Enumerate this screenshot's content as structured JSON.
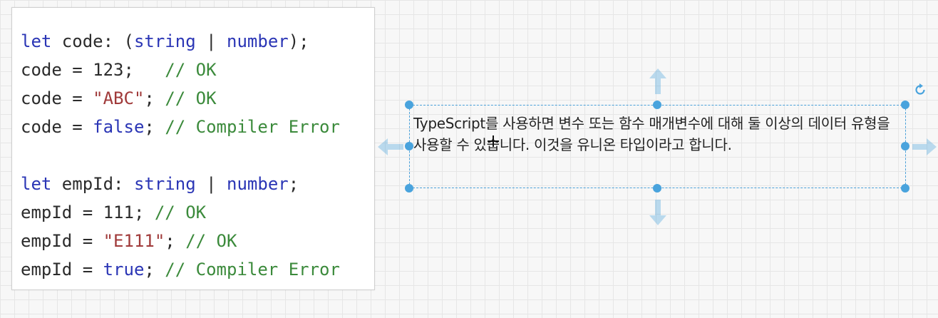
{
  "code_block": {
    "lines": [
      [
        {
          "t": "let",
          "k": "kw"
        },
        {
          "t": " code: (",
          "k": "plain"
        },
        {
          "t": "string",
          "k": "type"
        },
        {
          "t": " | ",
          "k": "plain"
        },
        {
          "t": "number",
          "k": "type"
        },
        {
          "t": ");",
          "k": "plain"
        }
      ],
      [
        {
          "t": "code = 123;   ",
          "k": "plain"
        },
        {
          "t": "// OK",
          "k": "cmt"
        }
      ],
      [
        {
          "t": "code = ",
          "k": "plain"
        },
        {
          "t": "\"ABC\"",
          "k": "str"
        },
        {
          "t": "; ",
          "k": "plain"
        },
        {
          "t": "// OK",
          "k": "cmt"
        }
      ],
      [
        {
          "t": "code = ",
          "k": "plain"
        },
        {
          "t": "false",
          "k": "kw"
        },
        {
          "t": "; ",
          "k": "plain"
        },
        {
          "t": "// Compiler Error",
          "k": "cmt"
        }
      ],
      [],
      [
        {
          "t": "let",
          "k": "kw"
        },
        {
          "t": " empId: ",
          "k": "plain"
        },
        {
          "t": "string",
          "k": "type"
        },
        {
          "t": " | ",
          "k": "plain"
        },
        {
          "t": "number",
          "k": "type"
        },
        {
          "t": ";",
          "k": "plain"
        }
      ],
      [
        {
          "t": "empId = 111; ",
          "k": "plain"
        },
        {
          "t": "// OK",
          "k": "cmt"
        }
      ],
      [
        {
          "t": "empId = ",
          "k": "plain"
        },
        {
          "t": "\"E111\"",
          "k": "str"
        },
        {
          "t": "; ",
          "k": "plain"
        },
        {
          "t": "// OK",
          "k": "cmt"
        }
      ],
      [
        {
          "t": "empId = ",
          "k": "plain"
        },
        {
          "t": "true",
          "k": "kw"
        },
        {
          "t": "; ",
          "k": "plain"
        },
        {
          "t": "// Compiler Error",
          "k": "cmt"
        }
      ]
    ]
  },
  "text_box": {
    "text": "TypeScript를 사용하면 변수 또는 함수 매개변수에 대해 둘 이상의 데이터 유형을 사용할 수 있습니다. 이것을 유니온 타입이라고 합니다."
  },
  "icons": {
    "rotate": "rotate-icon",
    "cursor": "move-cursor-icon",
    "arrow_up": "arrow-up-icon",
    "arrow_down": "arrow-down-icon",
    "arrow_left": "arrow-left-icon",
    "arrow_right": "arrow-right-icon"
  },
  "colors": {
    "keyword": "#2a35b5",
    "string": "#a03a3a",
    "comment": "#3b8a3b",
    "selection": "#49a3dd"
  }
}
